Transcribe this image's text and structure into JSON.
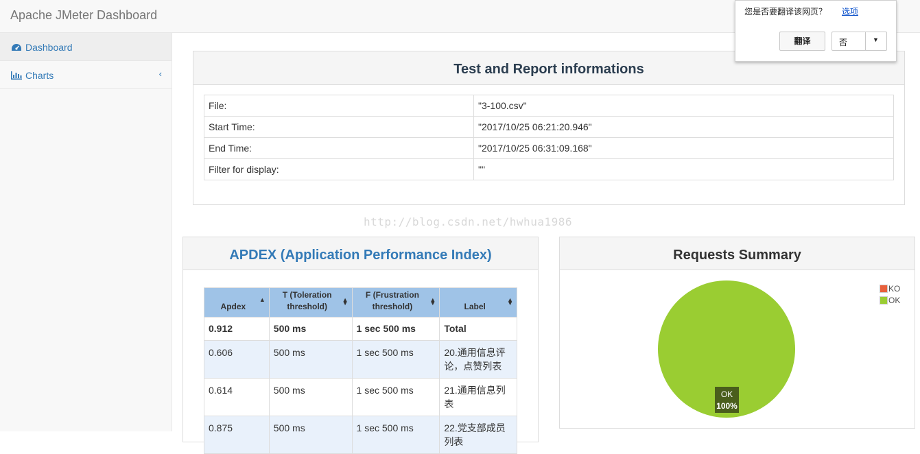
{
  "navbar": {
    "brand": "Apache JMeter Dashboard"
  },
  "sidebar": {
    "items": [
      {
        "label": "Dashboard",
        "icon": "dashboard-icon"
      },
      {
        "label": "Charts",
        "icon": "bar-chart-icon",
        "chevron": "‹"
      }
    ]
  },
  "info_panel": {
    "title": "Test and Report informations",
    "rows": [
      {
        "key": "File:",
        "value": "\"3-100.csv\""
      },
      {
        "key": "Start Time:",
        "value": "\"2017/10/25 06:21:20.946\""
      },
      {
        "key": "End Time:",
        "value": "\"2017/10/25 06:31:09.168\""
      },
      {
        "key": "Filter for display:",
        "value": "\"\""
      }
    ]
  },
  "watermark": "http://blog.csdn.net/hwhua1986",
  "apdex": {
    "title": "APDEX (Application Performance Index)",
    "headers": [
      "Apdex",
      "T (Toleration threshold)",
      "F (Frustration threshold)",
      "Label"
    ],
    "total": {
      "apdex": "0.912",
      "t": "500 ms",
      "f": "1 sec 500 ms",
      "label": "Total"
    },
    "rows": [
      {
        "apdex": "0.606",
        "t": "500 ms",
        "f": "1 sec 500 ms",
        "label": "20.通用信息评论，点赞列表"
      },
      {
        "apdex": "0.614",
        "t": "500 ms",
        "f": "1 sec 500 ms",
        "label": "21.通用信息列表"
      },
      {
        "apdex": "0.875",
        "t": "500 ms",
        "f": "1 sec 500 ms",
        "label": "22.党支部成员列表"
      }
    ]
  },
  "requests_summary": {
    "title": "Requests Summary",
    "legend": [
      {
        "name": "KO",
        "color": "#e8603c"
      },
      {
        "name": "OK",
        "color": "#9acd32"
      }
    ],
    "slice_label": "OK",
    "slice_percent": "100%"
  },
  "chart_data": {
    "type": "pie",
    "title": "Requests Summary",
    "categories": [
      "KO",
      "OK"
    ],
    "values": [
      0,
      100
    ],
    "colors": [
      "#e8603c",
      "#9acd32"
    ],
    "legend": "top-right"
  },
  "translate_popup": {
    "question": "您是否要翻译该网页？",
    "options_link": "选项",
    "translate_button": "翻译",
    "no_button": "否"
  }
}
